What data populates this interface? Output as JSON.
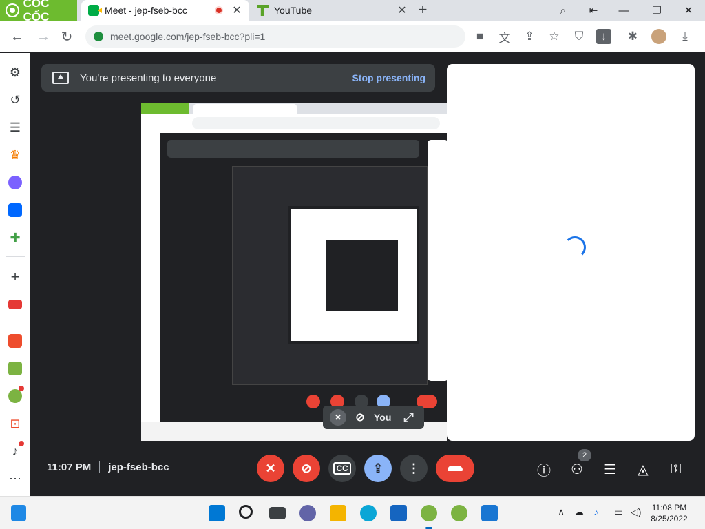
{
  "browser": {
    "brand": "CỐC CỐC",
    "tabs": [
      {
        "title": "Meet - jep-fseb-bcc",
        "active": true
      },
      {
        "title": "YouTube",
        "active": false
      }
    ],
    "url": "meet.google.com/jep-fseb-bcc?pli=1"
  },
  "meet": {
    "banner_text": "You're presenting to everyone",
    "stop_presenting": "Stop presenting",
    "self_label": "You",
    "time": "11:07 PM",
    "meeting_code": "jep-fseb-bcc",
    "participants_count": "2"
  },
  "taskbar": {
    "time": "11:08 PM",
    "date": "8/25/2022"
  },
  "colors": {
    "brand_green": "#6dbb2f",
    "meet_bg": "#202124",
    "danger": "#ea4335",
    "present_blue": "#8ab4f8"
  }
}
